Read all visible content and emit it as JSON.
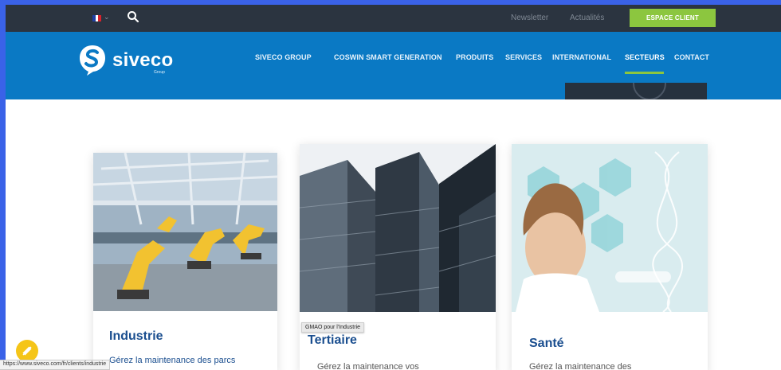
{
  "colors": {
    "page_bg": "#3a62e8",
    "topbar_bg": "#2b3440",
    "nav_bg": "#0a79c4",
    "accent_green": "#8cc63f",
    "card_title": "#1a4e8f"
  },
  "topbar": {
    "language_flag": "flag-fr-icon",
    "links": [
      "Newsletter",
      "Actualités"
    ],
    "client_button": "ESPACE CLIENT"
  },
  "logo": {
    "text": "siveco",
    "sub": "Group"
  },
  "nav": {
    "items": [
      "SIVECO GROUP",
      "COSWIN SMART GENERATION",
      "PRODUITS",
      "SERVICES",
      "INTERNATIONAL",
      "SECTEURS",
      "CONTACT"
    ],
    "active": "SECTEURS"
  },
  "cards": [
    {
      "title": "Industrie",
      "desc": "Gérez la maintenance des parcs"
    },
    {
      "title": "Tertiaire",
      "desc": "Gérez la maintenance vos"
    },
    {
      "title": "Santé",
      "desc": "Gérez la maintenance des"
    }
  ],
  "tooltip": "GMAO pour l'Industrie",
  "status_url": "https://www.siveco.com/fr/clients/industrie"
}
